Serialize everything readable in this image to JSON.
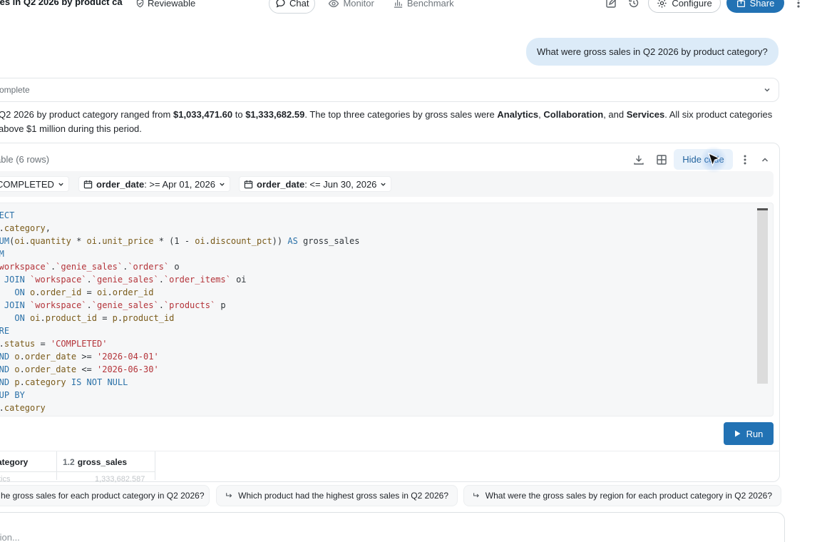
{
  "header": {
    "title": "les in Q2 2026 by product ca",
    "badge_label": "Reviewable",
    "tabs": [
      {
        "label": "Chat",
        "active": true
      },
      {
        "label": "Monitor",
        "active": false
      },
      {
        "label": "Benchmark",
        "active": false
      }
    ],
    "configure_label": "Configure",
    "share_label": "Share"
  },
  "conversation": {
    "user_question": "What were gross sales in Q2 2026 by product category?",
    "status_label": "omplete",
    "answer_text": {
      "p1": "Q2 2026 by product category ranged from ",
      "v1": "$1,033,471.60",
      "p2": " to ",
      "v2": "$1,333,682.59",
      "p3": ". The top three categories by gross sales were ",
      "c1": "Analytics",
      "p4": ", ",
      "c2": "Collaboration",
      "p5": ", and ",
      "c3": "Services",
      "p6": ". All six product categories",
      "line2": "above $1 million during this period."
    }
  },
  "result_card": {
    "label": "able (6 rows)",
    "hide_code_label": "Hide code",
    "filters": [
      {
        "field": "",
        "value": "COMPLETED"
      },
      {
        "field": "order_date",
        "value": ": >= Apr 01, 2026"
      },
      {
        "field": "order_date",
        "value": ": <= Jun 30, 2026"
      }
    ],
    "run_label": "Run",
    "columns": [
      {
        "type": "",
        "name": "ategory"
      },
      {
        "type": "1.2",
        "name": "gross_sales"
      }
    ],
    "first_row": [
      "tics",
      "1,333,682.587"
    ]
  },
  "suggestions": [
    "he gross sales for each product category in Q2 2026?",
    "Which product had the highest gross sales in Q2 2026?",
    "What were the gross sales by region for each product category in Q2 2026?"
  ],
  "input": {
    "placeholder": "tion..."
  },
  "colors": {
    "accent": "#2272b4",
    "user_bubble": "#dcebf8",
    "keyword": "#2b71a8",
    "string": "#b4343a"
  }
}
